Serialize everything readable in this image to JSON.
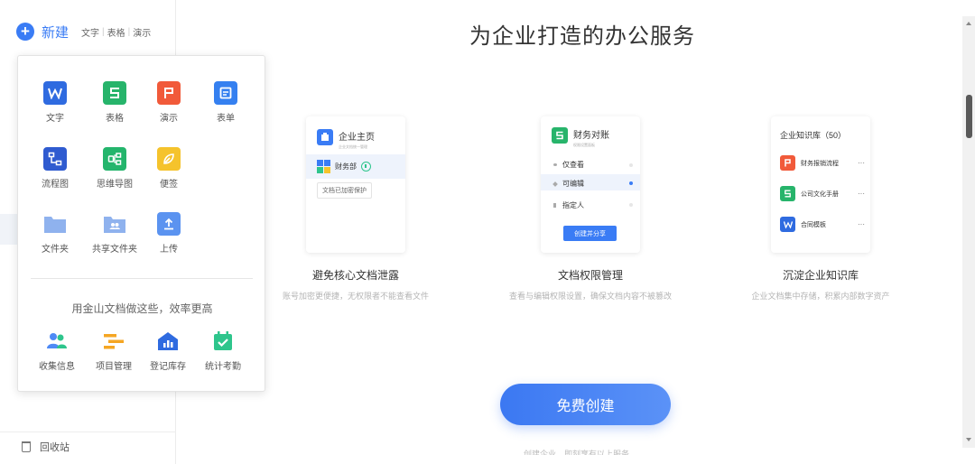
{
  "sidebar": {
    "new_label": "新建",
    "quick_links": [
      "文字",
      "表格",
      "演示"
    ],
    "trash_label": "回收站"
  },
  "dropdown": {
    "items": [
      {
        "label": "文字",
        "icon": "writer-doc-icon",
        "color": "#2f6be0"
      },
      {
        "label": "表格",
        "icon": "spreadsheet-icon",
        "color": "#27b46b"
      },
      {
        "label": "演示",
        "icon": "presentation-icon",
        "color": "#f15a3a"
      },
      {
        "label": "表单",
        "icon": "form-icon",
        "color": "#3580f0"
      },
      {
        "label": "流程图",
        "icon": "flowchart-icon",
        "color": "#2f5bd0"
      },
      {
        "label": "思维导图",
        "icon": "mindmap-icon",
        "color": "#24b56c"
      },
      {
        "label": "便签",
        "icon": "note-icon",
        "color": "#f5c32c"
      },
      {
        "label": "文件夹",
        "icon": "folder-icon",
        "color": "#8fb2ee"
      },
      {
        "label": "共享文件夹",
        "icon": "shared-folder-icon",
        "color": "#8fb2ee"
      },
      {
        "label": "上传",
        "icon": "upload-icon",
        "color": "#5b93f0"
      }
    ],
    "hint": "用金山文档做这些，效率更高",
    "apps": [
      {
        "label": "收集信息",
        "icon": "collect-info-icon"
      },
      {
        "label": "项目管理",
        "icon": "project-management-icon"
      },
      {
        "label": "登记库存",
        "icon": "inventory-icon"
      },
      {
        "label": "统计考勤",
        "icon": "attendance-icon"
      }
    ]
  },
  "main": {
    "title": "为企业打造的办公服务",
    "features": [
      {
        "title": "避免核心文档泄露",
        "desc": "账号加密更便捷，无权限者不能查看文件",
        "card": {
          "header": "企业主页",
          "sub": "企业文档统一管理",
          "row_label": "财务部",
          "tag": "文档已加密保护"
        }
      },
      {
        "title": "文档权限管理",
        "desc": "查看与编辑权限设置，确保文档内容不被篡改",
        "card": {
          "header": "财务对账",
          "sub": "权限设置面板",
          "options": [
            "仅查看",
            "可编辑",
            "指定人"
          ],
          "button": "创建并分享"
        }
      },
      {
        "title": "沉淀企业知识库",
        "desc": "企业文档集中存储，积累内部数字资产",
        "card": {
          "header": "企业知识库（50）",
          "files": [
            "财务报销流程",
            "公司文化手册",
            "合同模板"
          ]
        }
      }
    ],
    "cta": "免费创建",
    "cta_sub": "创建企业，即刻享有以上服务"
  }
}
